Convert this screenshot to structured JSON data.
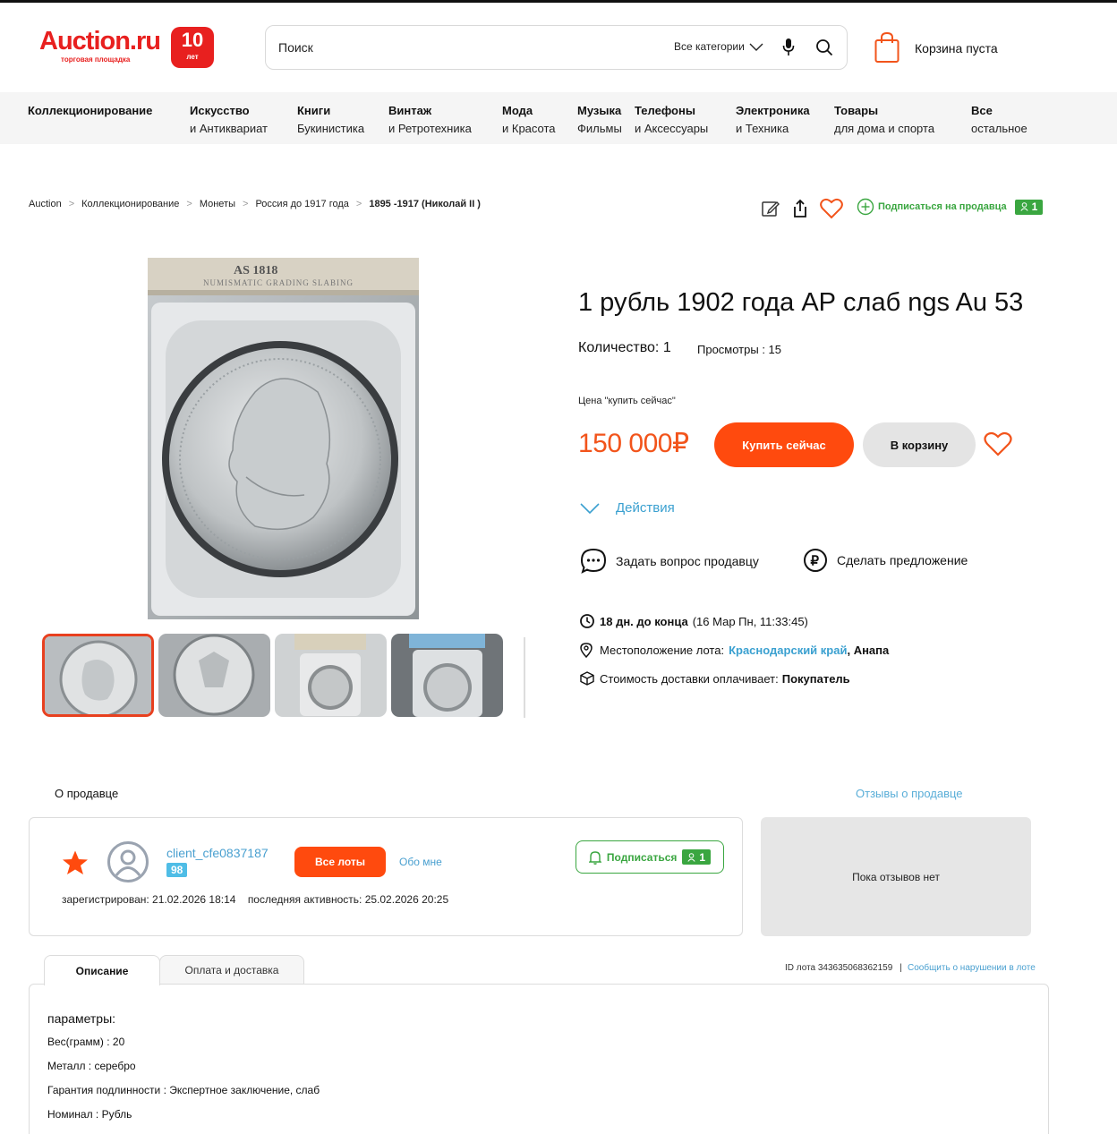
{
  "header": {
    "logo_text": "Auction.ru",
    "logo_sub": "торговая площадка",
    "logo_badge_num": "10",
    "logo_badge_label": "лет",
    "search_placeholder": "Поиск",
    "search_category": "Все категории",
    "cart_text": "Корзина пуста"
  },
  "nav": [
    {
      "line1": "Коллекционирование",
      "line2": ""
    },
    {
      "line1": "Искусство",
      "line2": "и Антиквариат"
    },
    {
      "line1": "Книги",
      "line2": "Букинистика"
    },
    {
      "line1": "Винтаж",
      "line2": "и Ретротехника"
    },
    {
      "line1": "Мода",
      "line2": "и Красота"
    },
    {
      "line1": "Музыка",
      "line2": "Фильмы"
    },
    {
      "line1": "Телефоны",
      "line2": "и Аксессуары"
    },
    {
      "line1": "Электроника",
      "line2": "и Техника"
    },
    {
      "line1": "Товары",
      "line2": "для дома и спорта"
    },
    {
      "line1": "Все",
      "line2": "остальное"
    }
  ],
  "breadcrumbs": [
    "Auction",
    "Коллекционирование",
    "Монеты",
    "Россия до 1917 года",
    "1895 -1917 (Николай II )"
  ],
  "subscribe_seller": {
    "label": "Подписаться на продавца",
    "count": "1"
  },
  "product": {
    "title": "1 рубль 1902 года АР слаб ngs Au 53",
    "quantity": "Количество: 1",
    "views": "Просмотры : 15",
    "price_label": "Цена \"купить сейчас\"",
    "price": "150 000₽",
    "buy_now": "Купить сейчас",
    "to_cart": "В корзину",
    "actions": "Действия",
    "ask_seller": "Задать вопрос продавцу",
    "make_offer": "Сделать предложение",
    "time_left": "18 дн. до конца",
    "end_date": "(16 Мар Пн, 11:33:45)",
    "location_label": "Местоположение лота:",
    "location_region": "Краснодарский край",
    "location_city": ", Анапа",
    "shipping_label": "Стоимость доставки оплачивает:",
    "shipping_payer": "Покупатель",
    "slab_text": "AS 1818",
    "slab_sub": "NUMISMATIC GRADING SLABING"
  },
  "seller": {
    "section_title": "О продавце",
    "reviews_link": "Отзывы о продавце",
    "name": "client_cfe0837187",
    "rating": "98",
    "all_lots": "Все лоты",
    "about_me": "Обо мне",
    "subscribe": "Подписаться",
    "subscribe_count": "1",
    "registered": "зарегистрирован: 21.02.2026 18:14",
    "last_active": "последняя активность: 25.02.2026 20:25",
    "no_reviews": "Пока отзывов нет"
  },
  "tabs": {
    "description": "Описание",
    "payment": "Оплата и доставка",
    "lot_id": "ID лота 343635068362159",
    "separator": "|",
    "report": "Сообщить о нарушении в лоте"
  },
  "description": {
    "title": "параметры:",
    "lines": [
      "Вес(грамм) : 20",
      "Металл : серебро",
      "Гарантия подлинности : Экспертное заключение, слаб",
      "Номинал : Рубль"
    ]
  },
  "colors": {
    "brand_red": "#e8201f",
    "buy_orange": "#ff4a0e",
    "price_orange": "#f2541b",
    "green": "#3aa640",
    "link_blue": "#3aa0d0"
  }
}
